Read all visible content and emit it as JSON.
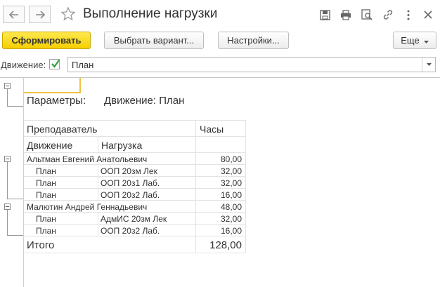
{
  "window": {
    "title": "Выполнение нагрузки",
    "back_icon": "arrow-left-icon",
    "forward_icon": "arrow-right-icon",
    "favorite_icon": "star-icon",
    "toolbar_icons": [
      "save-icon",
      "print-icon",
      "preview-icon",
      "link-icon",
      "more-icon",
      "close-icon"
    ]
  },
  "toolbar": {
    "generate_label": "Сформировать",
    "choose_variant_label": "Выбрать вариант...",
    "settings_label": "Настройки...",
    "more_label": "Еще"
  },
  "filter": {
    "label": "Движение:",
    "checked": true,
    "value": "План"
  },
  "report": {
    "params_label": "Параметры:",
    "params_value": "Движение: План",
    "headers": {
      "teacher": "Преподаватель",
      "hours": "Часы",
      "movement": "Движение",
      "load": "Нагрузка"
    },
    "groups": [
      {
        "teacher": "Альтман Евгений Анатольевич",
        "hours": "80,00",
        "rows": [
          {
            "movement": "План",
            "load": "ООП 20зм Лек",
            "hours": "32,00"
          },
          {
            "movement": "План",
            "load": "ООП 20з1 Лаб.",
            "hours": "32,00"
          },
          {
            "movement": "План",
            "load": "ООП 20з2 Лаб.",
            "hours": "16,00"
          }
        ]
      },
      {
        "teacher": "Малютин Андрей Геннадьевич",
        "hours": "48,00",
        "rows": [
          {
            "movement": "План",
            "load": "АдмИС 20зм Лек",
            "hours": "32,00"
          },
          {
            "movement": "План",
            "load": "ООП 20з2 Лаб.",
            "hours": "16,00"
          }
        ]
      }
    ],
    "total_label": "Итого",
    "total_value": "128,00"
  },
  "colors": {
    "primary_button": "#f5cf00",
    "checkbox_check": "#2e9e3e"
  }
}
